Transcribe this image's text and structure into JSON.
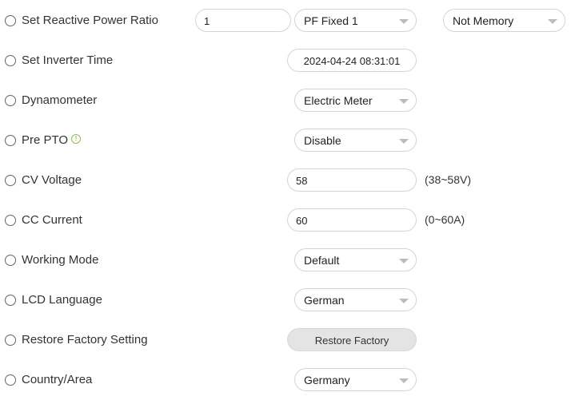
{
  "rows": {
    "reactive_power": {
      "label": "Set Reactive Power Ratio",
      "input_value": "1",
      "mode_select": "PF Fixed 1",
      "memory_select": "Not Memory"
    },
    "inverter_time": {
      "label": "Set Inverter Time",
      "value": "2024-04-24 08:31:01"
    },
    "dynamometer": {
      "label": "Dynamometer",
      "select": "Electric Meter"
    },
    "pre_pto": {
      "label": "Pre PTO",
      "info_icon": "!",
      "select": "Disable"
    },
    "cv_voltage": {
      "label": "CV Voltage",
      "value": "58",
      "range": "(38~58V)"
    },
    "cc_current": {
      "label": "CC Current",
      "value": "60",
      "range": "(0~60A)"
    },
    "working_mode": {
      "label": "Working Mode",
      "select": "Default"
    },
    "lcd_language": {
      "label": "LCD Language",
      "select": "German"
    },
    "restore_factory": {
      "label": "Restore Factory Setting",
      "button": "Restore Factory"
    },
    "country_area": {
      "label": "Country/Area",
      "select": "Germany"
    }
  },
  "colors": {
    "info_icon": "#8bc34a",
    "border": "#d4d4d4",
    "button_bg": "#e4e4e4"
  }
}
